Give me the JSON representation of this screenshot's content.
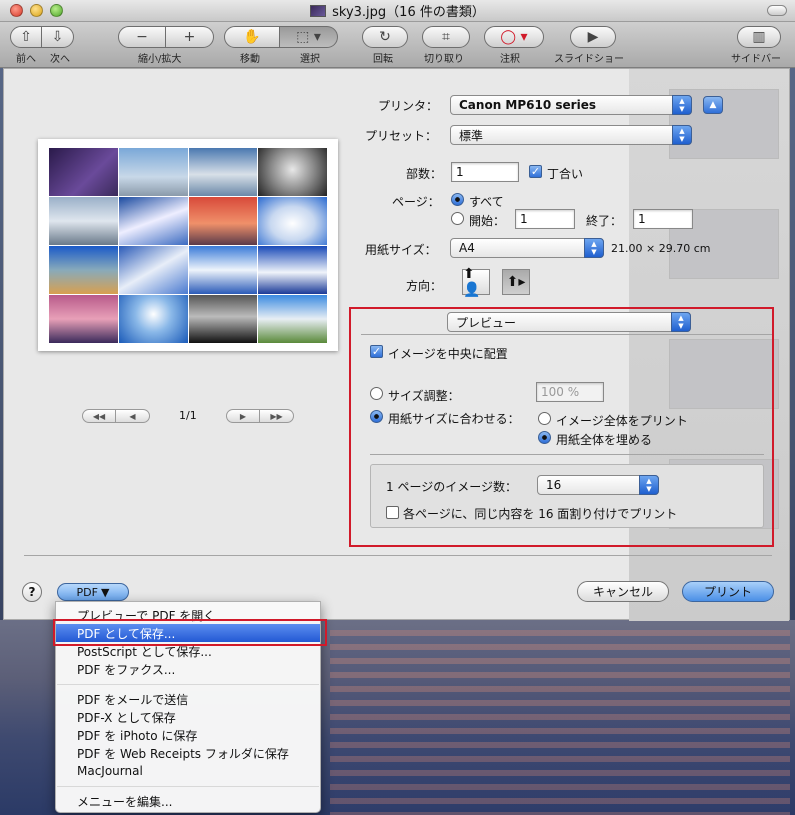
{
  "window": {
    "title": "sky3.jpg（16 件の書類）"
  },
  "toolbar": {
    "back_label": "前へ",
    "forward_label": "次へ",
    "zoom_label": "縮小/拡大",
    "move_label": "移動",
    "select_label": "選択",
    "rotate_label": "回転",
    "crop_label": "切り取り",
    "annotate_label": "注釈",
    "slideshow_label": "スライドショー",
    "sidebar_label": "サイドバー"
  },
  "preview": {
    "page_indicator": "1/1"
  },
  "settings": {
    "printer_label": "プリンタ：",
    "printer_value": "Canon MP610 series",
    "preset_label": "プリセット：",
    "preset_value": "標準",
    "copies_label": "部数：",
    "copies_value": "1",
    "collate_label": "丁合い",
    "pages_label": "ページ：",
    "pages_all_label": "すべて",
    "pages_from_label": "開始：",
    "pages_from_value": "1",
    "pages_to_label": "終了：",
    "pages_to_value": "1",
    "paper_size_label": "用紙サイズ：",
    "paper_size_value": "A4",
    "paper_dimensions": "21.00 × 29.70 cm",
    "orientation_label": "方向："
  },
  "preview_panel": {
    "section_value": "プレビュー",
    "center_image_label": "イメージを中央に配置",
    "scale_label": "サイズ調整：",
    "scale_value": "100 %",
    "fit_paper_label": "用紙サイズに合わせる：",
    "print_entire_image_label": "イメージ全体をプリント",
    "fill_paper_label": "用紙全体を埋める",
    "images_per_page_label": "1 ページのイメージ数：",
    "images_per_page_value": "16",
    "tile_label": "各ページに、同じ内容を 16 面割り付けでプリント"
  },
  "buttons": {
    "help": "?",
    "pdf": "PDF",
    "cancel": "キャンセル",
    "print": "プリント"
  },
  "pdf_menu": {
    "items": [
      "プレビューで PDF を開く",
      "PDF として保存...",
      "PostScript として保存...",
      "PDF をファクス...",
      "PDF をメールで送信",
      "PDF-X として保存",
      "PDF を iPhoto に保存",
      "PDF を Web Receipts フォルダに保存",
      "MacJournal",
      "メニューを編集..."
    ],
    "highlighted_index": 1
  },
  "colors": {
    "highlight": "#2359d4",
    "annotation_red": "#d11a2a"
  }
}
